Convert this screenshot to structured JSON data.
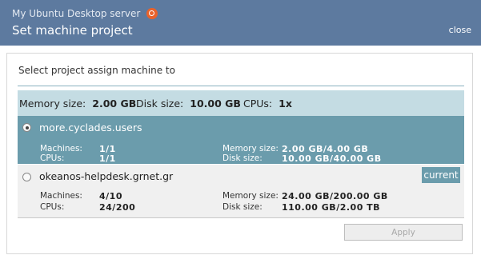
{
  "dialog": {
    "subtitle": "My Ubuntu Desktop server",
    "os_icon": "ubuntu-icon",
    "title": "Set machine project",
    "close_label": "close"
  },
  "prompt": "Select project assign machine to",
  "machine": {
    "memory_label": "Memory size:",
    "memory_value": "2.00 GB",
    "disk_label": "Disk size:",
    "disk_value": "10.00 GB",
    "cpus_label": "CPUs:",
    "cpus_value": "1x"
  },
  "projects": [
    {
      "name": "more.cyclades.users",
      "selected": true,
      "machines_label": "Machines:",
      "machines_value": "1/1",
      "cpus_label": "CPUs:",
      "cpus_value": "1/1",
      "memory_label": "Memory size:",
      "memory_value": "2.00 GB/4.00 GB",
      "disk_label": "Disk size:",
      "disk_value": "10.00 GB/40.00 GB"
    },
    {
      "name": "okeanos-helpdesk.grnet.gr",
      "selected": false,
      "badge": "current",
      "machines_label": "Machines:",
      "machines_value": "4/10",
      "cpus_label": "CPUs:",
      "cpus_value": "24/200",
      "memory_label": "Memory size:",
      "memory_value": "24.00 GB/200.00 GB",
      "disk_label": "Disk size:",
      "disk_value": "110.00 GB/2.00 TB"
    }
  ],
  "apply_label": "Apply"
}
